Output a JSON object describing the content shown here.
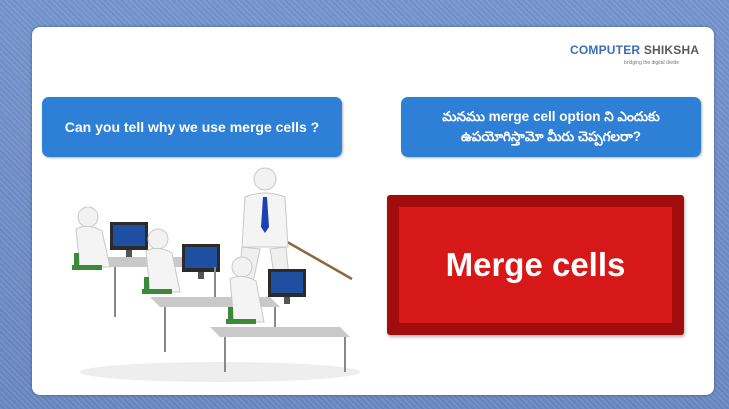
{
  "logo": {
    "part1": "COMPUTER",
    "part2": "SHIKSHA",
    "tagline": "bridging the digital divide"
  },
  "question_en": "Can you tell why we use merge cells ?",
  "question_te": "మనము merge cell option ని ఎందుకు ఉపయోగిస్తామో మీరు చెప్పగలరా?",
  "topic": "Merge cells",
  "colors": {
    "bubble": "#2e7fd6",
    "topic_outer": "#a10d0d",
    "topic_inner": "#d61818",
    "background": "#6f8fc8"
  },
  "illustration": "classroom-teacher-students-computers"
}
